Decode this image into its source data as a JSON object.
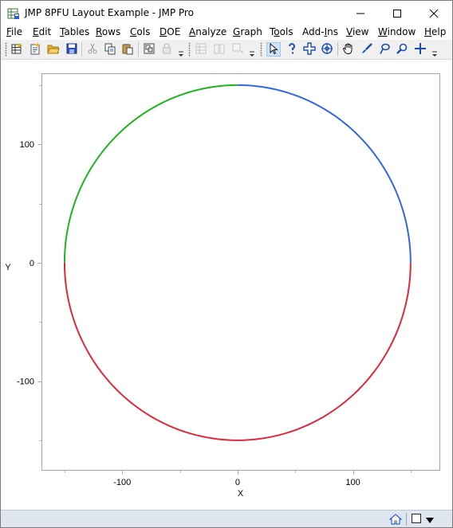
{
  "window": {
    "title": "JMP 8PFU Layout Example - JMP Pro",
    "controls": [
      "minimize-icon",
      "maximize-icon",
      "close-icon"
    ]
  },
  "menu": {
    "items": [
      {
        "pre": "",
        "u": "F",
        "post": "ile"
      },
      {
        "pre": "",
        "u": "E",
        "post": "dit"
      },
      {
        "pre": "",
        "u": "T",
        "post": "ables"
      },
      {
        "pre": "",
        "u": "R",
        "post": "ows"
      },
      {
        "pre": "",
        "u": "C",
        "post": "ols"
      },
      {
        "pre": "",
        "u": "D",
        "post": "OE"
      },
      {
        "pre": "",
        "u": "A",
        "post": "nalyze"
      },
      {
        "pre": "",
        "u": "G",
        "post": "raph"
      },
      {
        "pre": "T",
        "u": "o",
        "post": "ols"
      },
      {
        "pre": "Add-",
        "u": "I",
        "post": "ns"
      },
      {
        "pre": "",
        "u": "V",
        "post": "iew"
      },
      {
        "pre": "",
        "u": "W",
        "post": "indow"
      },
      {
        "pre": "",
        "u": "H",
        "post": "elp"
      }
    ]
  },
  "toolbar": {
    "icons": [
      "new-data-table-icon",
      "new-script-icon",
      "open-icon",
      "save-icon",
      "cut-icon",
      "copy-icon",
      "paste-icon",
      "copy-structure-icon",
      "lock-icon",
      "data-grid-icon",
      "split-icon",
      "join-icon",
      "arrow-tool-icon",
      "help-tool-icon",
      "selection-tool-icon",
      "crosshair-tool-icon",
      "hand-tool-icon",
      "brush-tool-icon",
      "lasso-tool-icon",
      "magnifier-tool-icon",
      "plus-tool-icon"
    ],
    "selected_tool": "arrow-tool-icon"
  },
  "chart_data": {
    "type": "line",
    "xlabel": "X",
    "ylabel": "Y",
    "xlim": [
      -170,
      175
    ],
    "ylim": [
      -175,
      160
    ],
    "xticks": [
      -100,
      0,
      100
    ],
    "yticks": [
      100,
      0,
      -100
    ],
    "grid": false,
    "series": [
      {
        "color": "#3366e6",
        "shape": "arc",
        "radius": 150,
        "center": [
          0,
          0
        ],
        "start_angle_deg": 0,
        "end_angle_deg": 90
      },
      {
        "color": "#1fb41f",
        "shape": "arc",
        "radius": 150,
        "center": [
          0,
          0
        ],
        "start_angle_deg": 90,
        "end_angle_deg": 180
      },
      {
        "color": "#e0283c",
        "shape": "arc",
        "radius": 150,
        "center": [
          0,
          0
        ],
        "start_angle_deg": 180,
        "end_angle_deg": 360
      }
    ]
  },
  "statusbar": {
    "icons": [
      "home-icon",
      "checkbox-icon",
      "dropdown-arrow-icon"
    ]
  }
}
